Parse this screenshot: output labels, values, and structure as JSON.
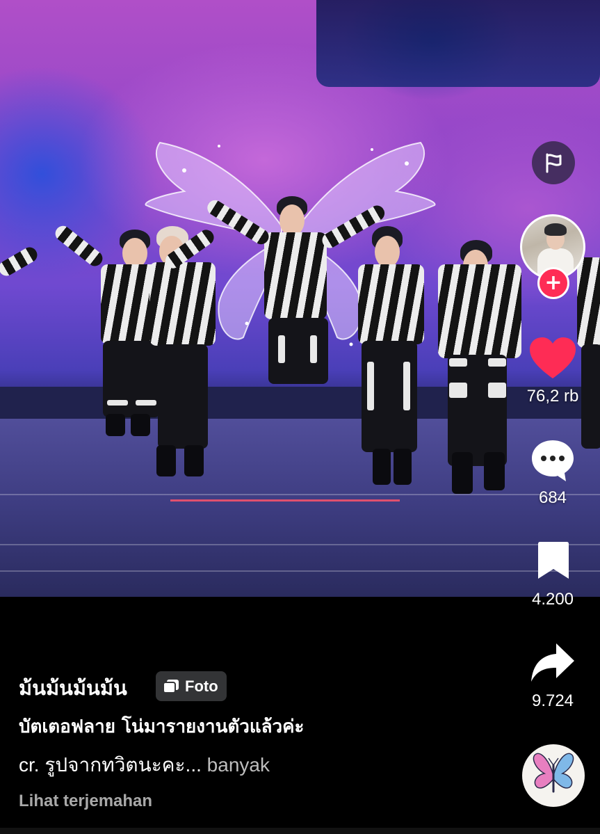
{
  "post": {
    "media_type": "photo",
    "username": "ม้นม้นม้นม้น",
    "badge_label": "Foto",
    "title": "บัตเตอฟลาย โน่มารายงานตัวแล้วค่ะ",
    "description": "cr. รูปจากทวิตนะคะ...",
    "more_label": "banyak",
    "translate_label": "Lihat terjemahan"
  },
  "actions": {
    "likes": "76,2 rb",
    "comments": "684",
    "bookmarks": "4.200",
    "shares": "9.724"
  },
  "colors": {
    "like": "#fe2c55",
    "follow": "#fe2c55",
    "background": "#000000"
  },
  "icons": [
    "flag-icon",
    "plus-icon",
    "heart-icon",
    "comment-icon",
    "bookmark-icon",
    "share-icon",
    "butterfly-icon",
    "photo-stack-icon"
  ]
}
